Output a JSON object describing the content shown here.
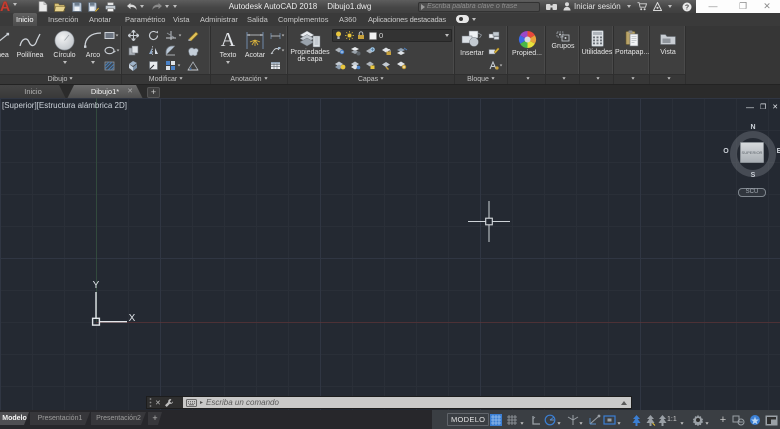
{
  "titlebar": {
    "app_title": "Autodesk AutoCAD 2018",
    "doc_title": "Dibujo1.dwg",
    "search_placeholder": "Escriba palabra clave o frase",
    "sign_in": "Iniciar sesión",
    "minimize": "—",
    "restore": "❐",
    "close": "✕"
  },
  "ribbon": {
    "tabs": [
      {
        "label": "Inicio"
      },
      {
        "label": "Inserción"
      },
      {
        "label": "Anotar"
      },
      {
        "label": "Paramétrico"
      },
      {
        "label": "Vista"
      },
      {
        "label": "Administrar"
      },
      {
        "label": "Salida"
      },
      {
        "label": "Complementos"
      },
      {
        "label": "A360"
      },
      {
        "label": "Aplicaciones destacadas"
      }
    ],
    "active_tab": "Inicio",
    "panels": {
      "dibujo": {
        "label": "Dibujo",
        "tools": {
          "linea": "Línea",
          "polilinea": "Polilínea",
          "circulo": "Círculo",
          "arco": "Arco"
        }
      },
      "modificar": {
        "label": "Modificar"
      },
      "anotacion": {
        "label": "Anotación",
        "tools": {
          "texto": "Texto",
          "acotar": "Acotar"
        }
      },
      "capas": {
        "label": "Capas",
        "big_button": "Propiedades de capa",
        "layer_name": "0"
      },
      "bloque": {
        "label": "Bloque",
        "big_button": "Insertar"
      },
      "propiedades": {
        "label": "Propied..."
      },
      "grupos": {
        "label": "Grupos"
      },
      "utilidades": {
        "label": "Utilidades"
      },
      "portapapeles": {
        "label": "Portapap..."
      },
      "vista": {
        "label": "Vista"
      }
    }
  },
  "file_tabs": {
    "inicio": "Inicio",
    "doc": "Dibujo1*",
    "close": "✕",
    "new_tab": "+"
  },
  "viewport": {
    "label": "[Superior][Estructura alámbrica 2D]",
    "viewcube": {
      "north": "N",
      "south": "S",
      "east": "E",
      "west": "O",
      "top_face": "SUPERIOR",
      "ucs_button": "SCU"
    },
    "axis_x_label": "X",
    "axis_y_label": "Y",
    "win_minimize": "—",
    "win_restore": "❐",
    "win_close": "✕"
  },
  "command_line": {
    "placeholder": "Escriba un comando",
    "close": "✕"
  },
  "bottom": {
    "layout_tabs": [
      {
        "label": "Modelo"
      },
      {
        "label": "Presentación1"
      },
      {
        "label": "Presentación2"
      }
    ],
    "new_layout": "+",
    "model_label": "MODELO",
    "annotation_scale": "1:1"
  },
  "colors": {
    "accent_blue": "#3b7fd4",
    "canvas_bg": "#242932",
    "autocad_red": "#c63c30",
    "command_field": "#c9c9c9"
  }
}
